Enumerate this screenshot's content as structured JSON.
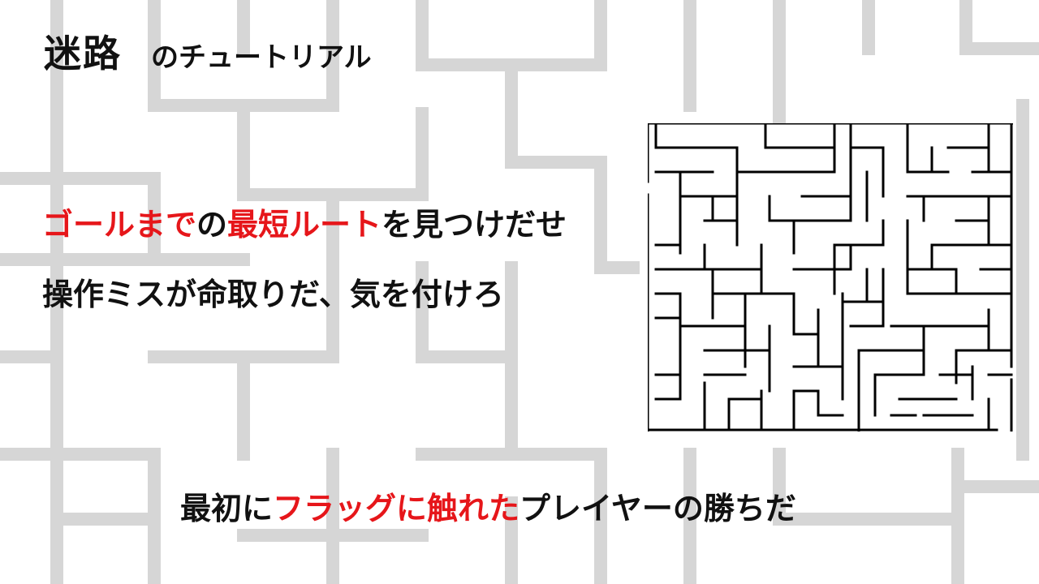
{
  "title": {
    "main": "迷路",
    "sub": "のチュートリアル"
  },
  "line1": [
    {
      "text": "ゴールまで",
      "red": true
    },
    {
      "text": "の",
      "red": false
    },
    {
      "text": "最短ルート",
      "red": true
    },
    {
      "text": "を見つけだせ",
      "red": false
    }
  ],
  "line2": [
    {
      "text": "操作ミスが命取りだ、気を付けろ",
      "red": false
    }
  ],
  "line3": [
    {
      "text": "最初に",
      "red": false
    },
    {
      "text": "フラッグに触れた",
      "red": true
    },
    {
      "text": "プレイヤーの勝ちだ",
      "red": false
    }
  ],
  "colors": {
    "text": "#111111",
    "accent": "#e6161a",
    "maze_wall": "#000000",
    "background_maze": "#d6d6d6"
  }
}
